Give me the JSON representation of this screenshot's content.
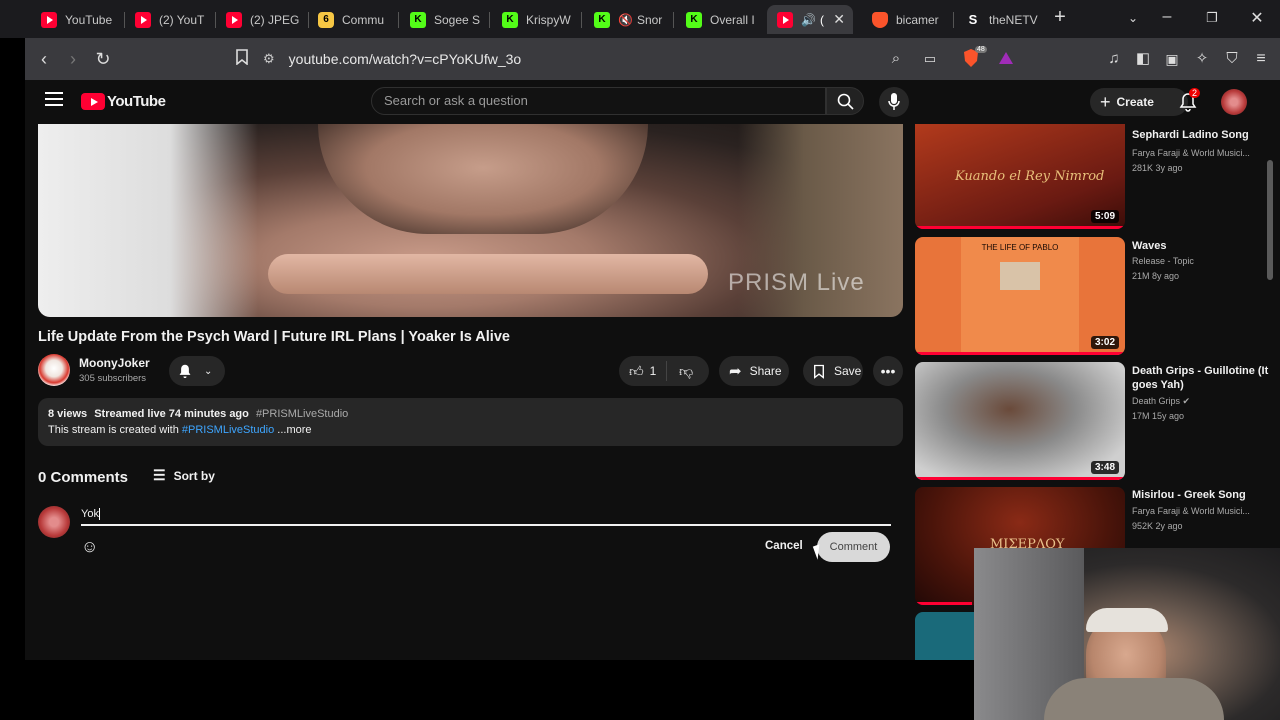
{
  "browser": {
    "tabs": [
      {
        "label": "YouTube",
        "icon": "youtube-icon"
      },
      {
        "label": "(2) YouT",
        "icon": "youtube-icon"
      },
      {
        "label": "(2) JPEG",
        "icon": "youtube-icon"
      },
      {
        "label": "Commu",
        "icon": "commu-icon"
      },
      {
        "label": "Sogee S",
        "icon": "kick-icon"
      },
      {
        "label": "KrispyW",
        "icon": "kick-icon"
      },
      {
        "label": "Snor",
        "icon": "kick-icon"
      },
      {
        "label": "Overall I",
        "icon": "kick-icon"
      },
      {
        "label": "(",
        "icon": "youtube-icon"
      },
      {
        "label": "bicamer",
        "icon": "brave-icon"
      },
      {
        "label": "theNETV",
        "icon": "s-icon"
      }
    ],
    "url": "youtube.com/watch?v=cPYoKUfw_3o",
    "brave_badge": "48"
  },
  "youtube": {
    "logo_text": "YouTube",
    "search_placeholder": "Search or ask a question",
    "create_label": "Create",
    "notification_count": "2"
  },
  "video": {
    "overlay_watermark": "PRISM Live",
    "title": "Life Update From the Psych Ward | Future IRL Plans | Yoaker Is Alive",
    "channel_name": "MoonyJoker",
    "subscribers": "305 subscribers",
    "like_count": "1",
    "share_label": "Share",
    "save_label": "Save"
  },
  "description": {
    "views": "8 views",
    "streamed": "Streamed live 74 minutes ago",
    "hashtag": "#PRISMLiveStudio",
    "line2_prefix": "This stream is created with",
    "line2_link": "#PRISMLiveStudio",
    "more": "...more"
  },
  "comments": {
    "count_label": "0 Comments",
    "sort_label": "Sort by",
    "input_value": "Yok",
    "cancel_label": "Cancel",
    "comment_label": "Comment"
  },
  "sidebar": {
    "items": [
      {
        "title": "Sephardi Ladino Song",
        "channel": "Farya Faraji & World Musici...",
        "meta": "281K  3y ago",
        "duration": "5:09",
        "thumb_text": "Kuando el Rey Nimrod",
        "colors": [
          "#6a1a12",
          "#b23a1c"
        ],
        "progress": 1.0
      },
      {
        "title": "Waves",
        "channel": "Release - Topic",
        "meta": "21M  8y ago",
        "duration": "3:02",
        "thumb_text": "THE LIFE OF PABLO",
        "colors": [
          "#f08a4b",
          "#e8743a"
        ],
        "progress": 1.0
      },
      {
        "title": "Death Grips - Guillotine (It goes Yah)",
        "channel": "Death Grips",
        "meta": "17M  15y ago",
        "duration": "3:48",
        "thumb_text": "",
        "colors": [
          "#6a6a6a",
          "#3c3c3c"
        ],
        "progress": 1.0
      },
      {
        "title": "Misirlou - Greek Song",
        "channel": "Farya Faraji & World Musici...",
        "meta": "952K  2y ago",
        "duration": "",
        "thumb_text": "ΜΙΣΕΡΛΟΥ",
        "colors": [
          "#5a1a10",
          "#2a0c08"
        ],
        "progress": 0.27
      }
    ]
  }
}
